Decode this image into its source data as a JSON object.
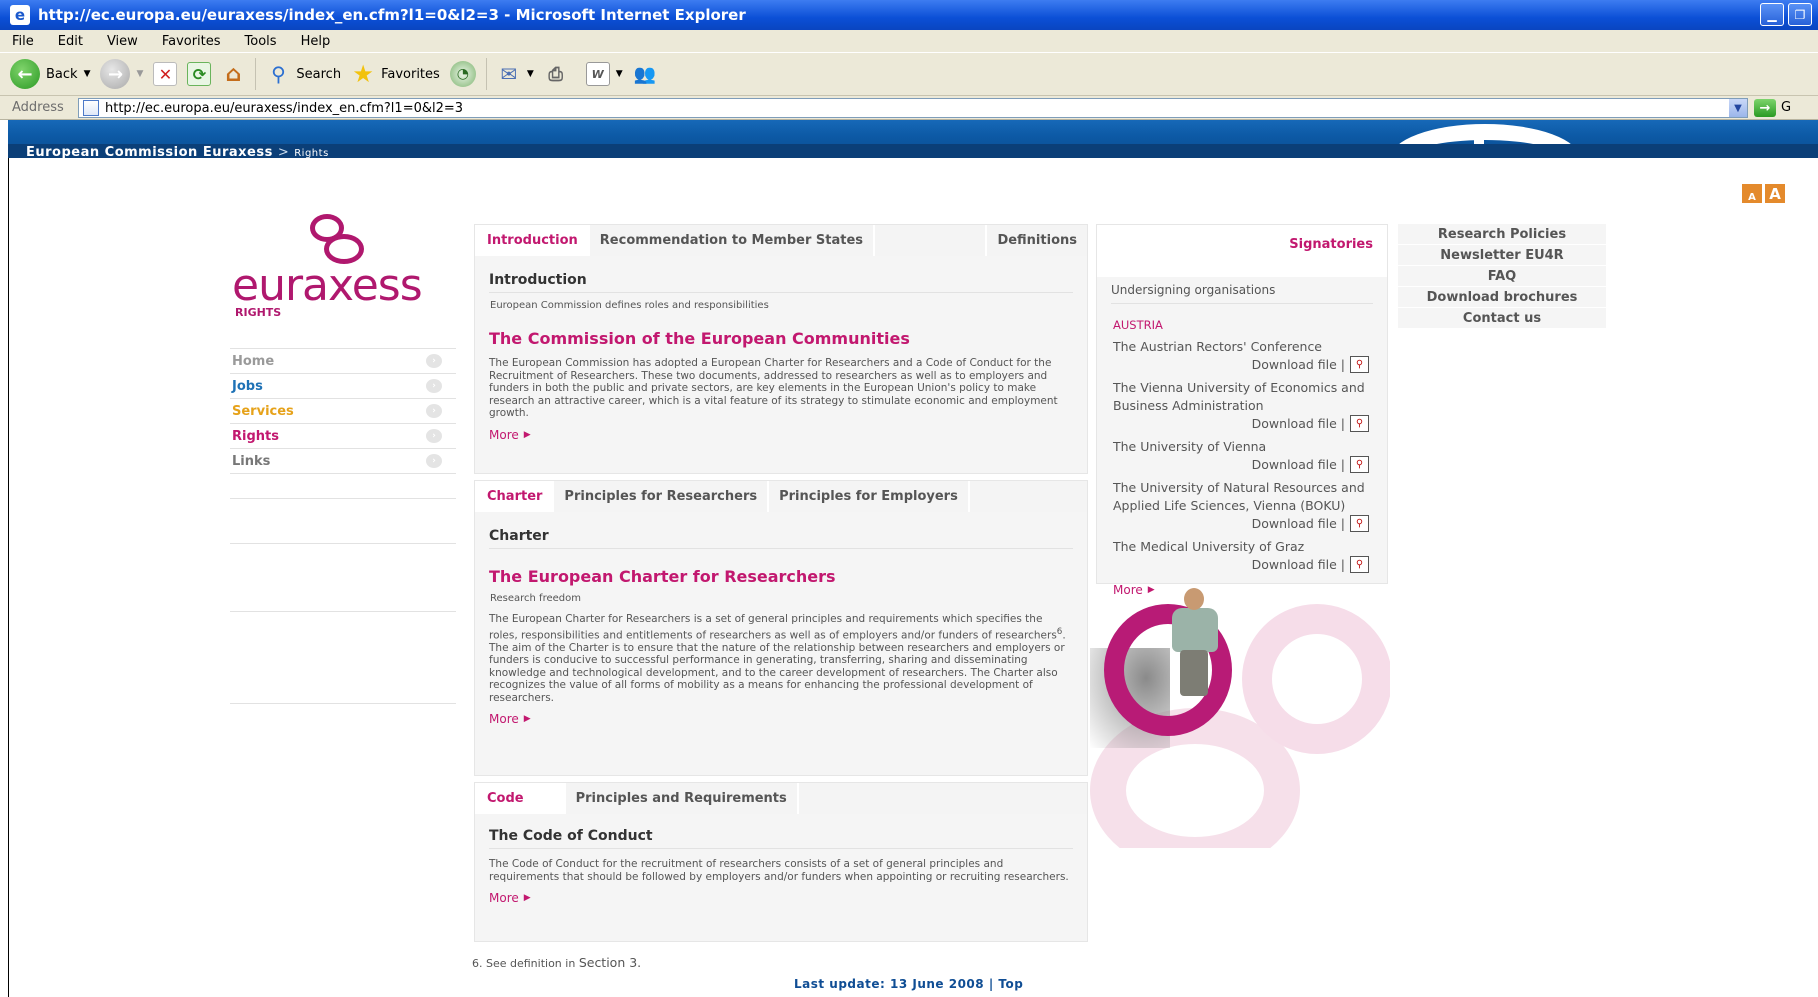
{
  "window": {
    "title": "http://ec.europa.eu/euraxess/index_en.cfm?l1=0&l2=3 - Microsoft Internet Explorer"
  },
  "menu": [
    "File",
    "Edit",
    "View",
    "Favorites",
    "Tools",
    "Help"
  ],
  "toolbar": {
    "back": "Back",
    "search": "Search",
    "favorites": "Favorites"
  },
  "address": {
    "label": "Address",
    "url": "http://ec.europa.eu/euraxess/index_en.cfm?l1=0&l2=3",
    "go": "G"
  },
  "site": {
    "brand": "European Commission Euraxess",
    "crumb_sep": ">",
    "crumb_current": "Rights",
    "logo_word": "euraxess",
    "logo_sub": "RIGHTS",
    "font_small": "A",
    "font_large": "A"
  },
  "leftnav": [
    {
      "label": "Home",
      "color": "#9a9a9a"
    },
    {
      "label": "Jobs",
      "color": "#1f72b6"
    },
    {
      "label": "Services",
      "color": "#e6a21a"
    },
    {
      "label": "Rights",
      "color": "#c2186f"
    },
    {
      "label": "Links",
      "color": "#777777"
    }
  ],
  "intro": {
    "tabs": [
      "Introduction",
      "Recommendation to Member States",
      "Definitions"
    ],
    "section_title": "Introduction",
    "subtitle": "European Commission defines roles and responsibilities",
    "heading": "The Commission of the European Communities",
    "body": "The European Commission has adopted a European Charter for Researchers and a Code of Conduct for the Recruitment of Researchers. These two documents, addressed to researchers as well as to employers and funders in both the public and private sectors, are key elements in the European Union's policy to make research an attractive career, which is a vital feature of its strategy to stimulate economic and employment growth.",
    "more": "More"
  },
  "charter": {
    "tabs": [
      "Charter",
      "Principles for Researchers",
      "Principles for Employers"
    ],
    "section_title": "Charter",
    "heading": "The European Charter for Researchers",
    "subtitle": "Research freedom",
    "body_a": "The European Charter for Researchers is a set of general principles and requirements which specifies the roles, responsibilities and entitlements of researchers as well as of employers and/or funders of researchers",
    "body_sup": "6",
    "body_b": ". The aim of the Charter is to ensure that the nature of the relationship between researchers and employers or funders is conducive to successful performance in generating, transferring, sharing and disseminating knowledge and technological development, and to the career development of researchers. The Charter also recognizes the value of all forms of mobility as a means for enhancing the professional development of researchers.",
    "more": "More"
  },
  "code": {
    "tabs": [
      "Code",
      "Principles and Requirements"
    ],
    "heading": "The Code of Conduct",
    "body": "The Code of Conduct for the recruitment of researchers consists of a set of general principles and requirements that should be followed by employers and/or funders when appointing or recruiting researchers.",
    "more": "More"
  },
  "signatories": {
    "title": "Signatories",
    "subtitle": "Undersigning organisations",
    "country": "AUSTRIA",
    "download_label": "Download file |",
    "orgs": [
      "The Austrian Rectors' Conference",
      "The Vienna University of Economics and Business Administration",
      "The University of Vienna",
      "The University of Natural Resources and Applied Life Sciences, Vienna (BOKU)",
      "The Medical University of Graz"
    ],
    "more": "More"
  },
  "rightnav": [
    "Research Policies",
    "Newsletter EU4R",
    "FAQ",
    "Download brochures",
    "Contact us"
  ],
  "footer": {
    "footnote": "6. See definition in",
    "footnote_section": "Section 3.",
    "last_update": "Last update: 13 June 2008",
    "sep": "|",
    "top": "Top"
  }
}
